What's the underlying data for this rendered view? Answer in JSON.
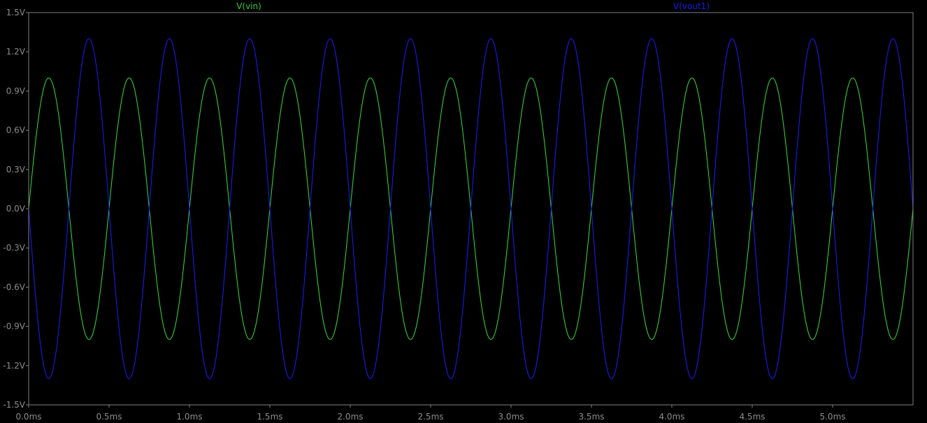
{
  "colors": {
    "background": "#000000",
    "frame": "#808080",
    "tick_label": "#8c8c8c",
    "vin": "#33cc33",
    "vout1": "#1a1aee"
  },
  "chart_data": {
    "type": "line",
    "title": "",
    "xlabel": "",
    "ylabel": "",
    "xlim": [
      0,
      5.5
    ],
    "ylim": [
      -1.5,
      1.5
    ],
    "x_unit": "ms",
    "y_unit": "V",
    "grid": false,
    "x_ticks": [
      "0.0ms",
      "0.5ms",
      "1.0ms",
      "1.5ms",
      "2.0ms",
      "2.5ms",
      "3.0ms",
      "3.5ms",
      "4.0ms",
      "4.5ms",
      "5.0ms"
    ],
    "y_ticks": [
      "1.5V",
      "1.2V",
      "0.9V",
      "0.6V",
      "0.3V",
      "0.0V",
      "-0.3V",
      "-0.6V",
      "-0.9V",
      "-1.2V",
      "-1.5V"
    ],
    "series": [
      {
        "name": "V(vin)",
        "key": "vin",
        "waveform": "sine",
        "amplitude": 1.0,
        "frequency_khz": 2.0,
        "phase_deg": 0,
        "offset": 0.0
      },
      {
        "name": "V(vout1)",
        "key": "vout1",
        "waveform": "sine",
        "amplitude": 1.3,
        "frequency_khz": 2.0,
        "phase_deg": 180,
        "offset": 0.0
      }
    ]
  }
}
